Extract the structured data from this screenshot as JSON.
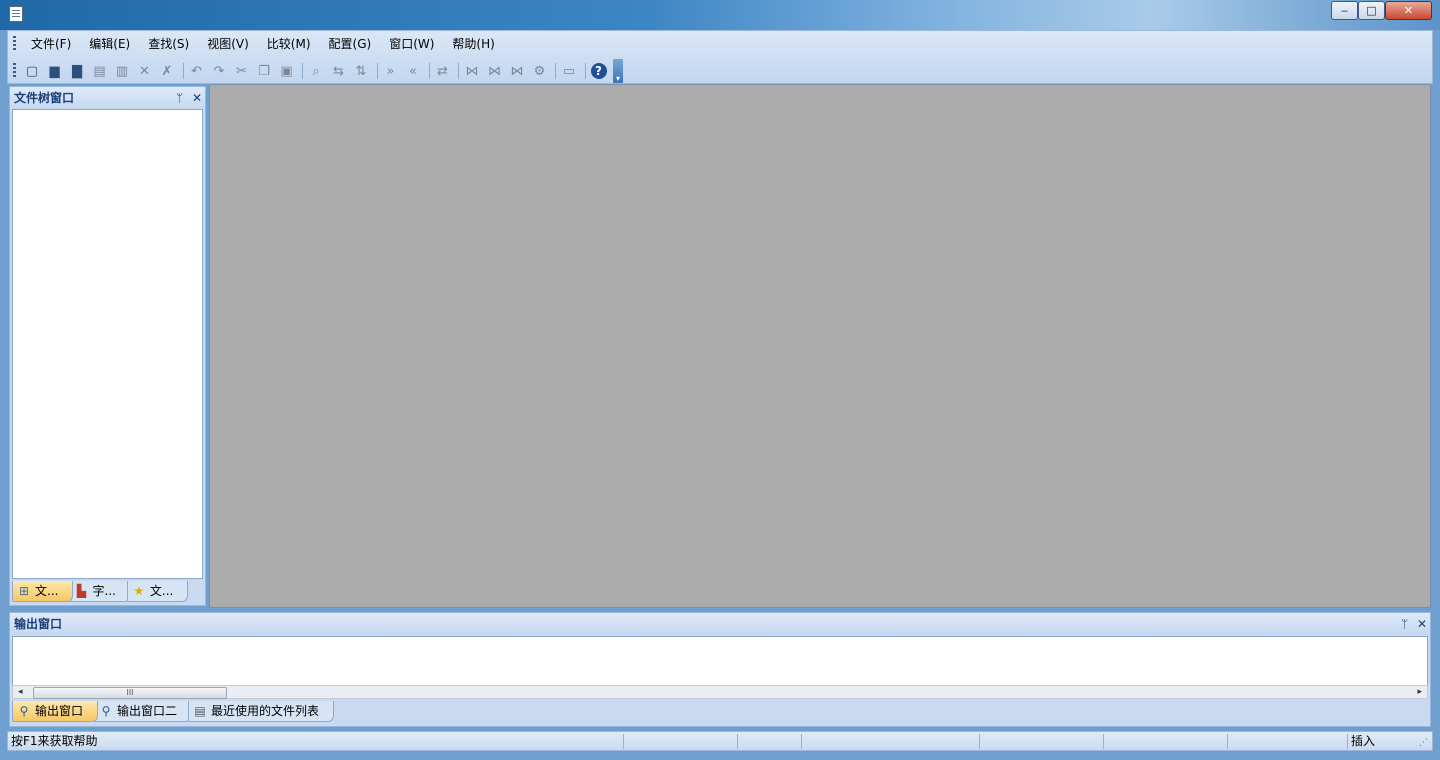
{
  "window": {
    "min_symbol": "‒",
    "max_symbol": "□",
    "close_symbol": "✕"
  },
  "menu": {
    "items": [
      "文件(F)",
      "编辑(E)",
      "查找(S)",
      "视图(V)",
      "比较(M)",
      "配置(G)",
      "窗口(W)",
      "帮助(H)"
    ]
  },
  "toolbar": {
    "icons": [
      {
        "name": "new-file-icon",
        "glyph": "▢",
        "enabled": true
      },
      {
        "name": "open-folder-icon",
        "glyph": "▆",
        "enabled": true
      },
      {
        "name": "open-project-icon",
        "glyph": "▇",
        "enabled": true
      },
      {
        "name": "save-icon",
        "glyph": "▤",
        "enabled": false
      },
      {
        "name": "save-all-icon",
        "glyph": "▥",
        "enabled": false
      },
      {
        "name": "delete-icon",
        "glyph": "✕",
        "enabled": false
      },
      {
        "name": "delete-all-icon",
        "glyph": "✗",
        "enabled": false
      },
      {
        "name": "undo-icon",
        "glyph": "↶",
        "enabled": false
      },
      {
        "name": "redo-icon",
        "glyph": "↷",
        "enabled": false
      },
      {
        "name": "cut-icon",
        "glyph": "✂",
        "enabled": false
      },
      {
        "name": "copy-icon",
        "glyph": "❐",
        "enabled": false
      },
      {
        "name": "paste-icon",
        "glyph": "▣",
        "enabled": false
      },
      {
        "name": "find-icon",
        "glyph": "⌕",
        "enabled": false
      },
      {
        "name": "replace-icon",
        "glyph": "⇆",
        "enabled": false
      },
      {
        "name": "sort-icon",
        "glyph": "⇅",
        "enabled": false
      },
      {
        "name": "next-diff-icon",
        "glyph": "»",
        "enabled": false
      },
      {
        "name": "prev-diff-icon",
        "glyph": "«",
        "enabled": false
      },
      {
        "name": "compare-icon",
        "glyph": "⇄",
        "enabled": false
      },
      {
        "name": "merge-left-icon",
        "glyph": "⋈",
        "enabled": false
      },
      {
        "name": "merge-right-icon",
        "glyph": "⋈",
        "enabled": false
      },
      {
        "name": "merge-all-icon",
        "glyph": "⋈",
        "enabled": false
      },
      {
        "name": "merge-settings-icon",
        "glyph": "⚙",
        "enabled": false
      },
      {
        "name": "hex-view-icon",
        "glyph": "▭",
        "enabled": false
      }
    ],
    "help_glyph": "?",
    "overflow_glyph": "▾"
  },
  "left_pane": {
    "title": "文件树窗口",
    "pin_glyph": "ᛘ",
    "close_glyph": "✕",
    "tabs": [
      {
        "label": "文...",
        "icon": "file-tree-icon",
        "glyph": "⊞",
        "color": "#4a6d99"
      },
      {
        "label": "字...",
        "icon": "dictionary-icon",
        "glyph": "▙",
        "color": "#c0392b"
      },
      {
        "label": "文...",
        "icon": "favorites-star-icon",
        "glyph": "★",
        "color": "#e0a800"
      }
    ]
  },
  "output_pane": {
    "title": "输出窗口",
    "pin_glyph": "ᛘ",
    "close_glyph": "✕",
    "scroll_left": "◂",
    "scroll_right": "▸",
    "thumb_grip": "III",
    "tabs": [
      {
        "label": "输出窗口",
        "icon": "output-icon",
        "glyph": "⚲",
        "color": "#2d5a94"
      },
      {
        "label": "输出窗口二",
        "icon": "output-two-icon",
        "glyph": "⚲",
        "color": "#2d5a94"
      },
      {
        "label": "最近使用的文件列表",
        "icon": "recent-files-icon",
        "glyph": "▤",
        "color": "#556"
      }
    ]
  },
  "status": {
    "text": "按F1来获取帮助",
    "mode": "插入",
    "grip": "⋰"
  }
}
